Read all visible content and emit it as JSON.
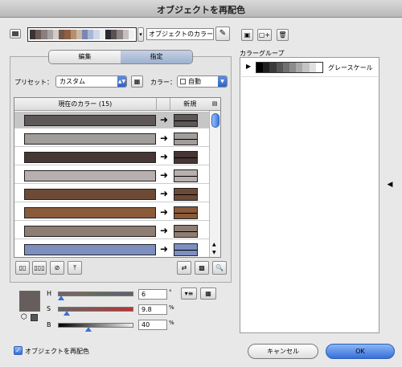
{
  "window": {
    "title": "オブジェクトを再配色"
  },
  "toolbar": {
    "colors_dropdown_value": "オブジェクトのカラー",
    "swatches": [
      "#3b3333",
      "#6a5a55",
      "#8a7f7d",
      "#a7a2a3",
      "#d4cbc8",
      "#705748",
      "#8f5f42",
      "#b68f6d",
      "#c9b8aa",
      "#7b86b2",
      "#a7b8d6",
      "#cfd6e7",
      "#ecedf0",
      "#2b2a2e",
      "#5b5054",
      "#8e8686",
      "#c4c0bd",
      "#f1efef"
    ]
  },
  "tabs": {
    "edit": "編集",
    "assign": "指定"
  },
  "preset": {
    "label": "プリセット：",
    "value": "カスタム"
  },
  "color_mode": {
    "label": "カラー：",
    "value": "自動"
  },
  "table": {
    "col_current": "現在のカラー (15)",
    "col_new": "新規",
    "rows": [
      {
        "current": "#5e5757",
        "new": "#5e5757",
        "selected": true
      },
      {
        "current": "#a19d9b",
        "new": "#a19d9b",
        "selected": false
      },
      {
        "current": "#463634",
        "new": "#463634",
        "selected": false
      },
      {
        "current": "#b7b0ae",
        "new": "#b7b0ae",
        "selected": false
      },
      {
        "current": "#6e4a36",
        "new": "#6e4a36",
        "selected": false
      },
      {
        "current": "#8a5a3a",
        "new": "#8a5a3a",
        "selected": false
      },
      {
        "current": "#8e7d72",
        "new": "#8e7d72",
        "selected": false
      },
      {
        "current": "#7d8fbf",
        "new": "#7d8fbf",
        "selected": false
      }
    ]
  },
  "hsb": {
    "h_label": "H",
    "s_label": "S",
    "b_label": "B",
    "h_value": "6",
    "s_value": "9.8",
    "b_value": "40",
    "h_unit": "°",
    "s_unit": "%",
    "b_unit": "%",
    "current_color": "#665e5c"
  },
  "groups": {
    "label": "カラーグループ",
    "items": [
      {
        "name": "グレースケール"
      }
    ],
    "grays": [
      "#000000",
      "#1f1f1f",
      "#3a3a3a",
      "#555555",
      "#707070",
      "#8c8c8c",
      "#a8a8a8",
      "#c4c4c4",
      "#e0e0e0",
      "#ffffff"
    ]
  },
  "footer": {
    "recolor_checkbox_label": "オブジェクトを再配色",
    "recolor_checked": true,
    "cancel_label": "キャンセル",
    "ok_label": "OK"
  }
}
